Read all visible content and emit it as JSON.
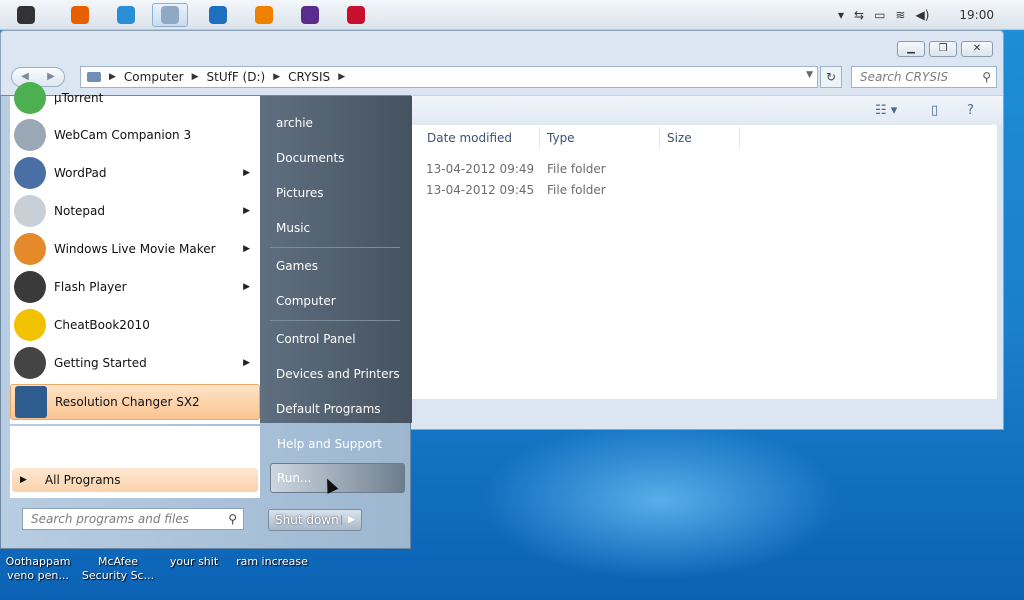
{
  "taskbar": {
    "clock": "19:00",
    "icons": [
      {
        "name": "apple-icon",
        "color": "#333333"
      },
      {
        "name": "firefox-icon",
        "color": "#e66000"
      },
      {
        "name": "ie-icon",
        "color": "#2a8fd6"
      },
      {
        "name": "explorer-icon",
        "color": "#8fa8c4"
      },
      {
        "name": "quicktime-icon",
        "color": "#1e6fbf"
      },
      {
        "name": "vlc-icon",
        "color": "#f08000"
      },
      {
        "name": "media-icon",
        "color": "#5a2d8c"
      },
      {
        "name": "mcafee-icon",
        "color": "#c8102e"
      }
    ]
  },
  "explorer": {
    "address": {
      "segments": [
        "Computer",
        "StUfF (D:)",
        "CRYSIS"
      ]
    },
    "search_placeholder": "Search CRYSIS",
    "columns": [
      "Date modified",
      "Type",
      "Size"
    ],
    "rows": [
      {
        "date": "13-04-2012 09:49",
        "type": "File folder"
      },
      {
        "date": "13-04-2012 09:45",
        "type": "File folder"
      }
    ]
  },
  "start_menu": {
    "programs": [
      {
        "label": "µTorrent",
        "color": "#4caf50",
        "has_arrow": false
      },
      {
        "label": "WebCam Companion 3",
        "color": "#9aa7b5",
        "has_arrow": false
      },
      {
        "label": "WordPad",
        "color": "#4a6fa5",
        "has_arrow": true
      },
      {
        "label": "Notepad",
        "color": "#c9cfd6",
        "has_arrow": true
      },
      {
        "label": "Windows Live Movie Maker",
        "color": "#e58a2a",
        "has_arrow": true
      },
      {
        "label": "Flash Player",
        "color": "#3a3a3a",
        "has_arrow": true
      },
      {
        "label": "CheatBook2010",
        "color": "#f2c200",
        "has_arrow": false
      },
      {
        "label": "Getting Started",
        "color": "#444444",
        "has_arrow": true
      },
      {
        "label": "Resolution Changer SX2",
        "color": "#2f5c8e",
        "has_arrow": false
      }
    ],
    "all_programs": "All Programs",
    "search_placeholder": "Search programs and files",
    "right_items": [
      {
        "label": "archie",
        "sep_after": false
      },
      {
        "label": "Documents",
        "sep_after": false
      },
      {
        "label": "Pictures",
        "sep_after": false
      },
      {
        "label": "Music",
        "sep_after": true
      },
      {
        "label": "Games",
        "sep_after": false
      },
      {
        "label": "Computer",
        "sep_after": true
      },
      {
        "label": "Control Panel",
        "sep_after": false
      },
      {
        "label": "Devices and Printers",
        "sep_after": false
      },
      {
        "label": "Default Programs",
        "sep_after": false
      }
    ],
    "help": "Help and Support",
    "run": "Run...",
    "shutdown": "Shut down"
  },
  "desktop_icons": [
    {
      "line1": "Oothappam",
      "line2": "veno pen..."
    },
    {
      "line1": "McAfee",
      "line2": "Security Sc..."
    },
    {
      "line1": "your shit",
      "line2": ""
    },
    {
      "line1": "ram increase",
      "line2": ""
    }
  ]
}
